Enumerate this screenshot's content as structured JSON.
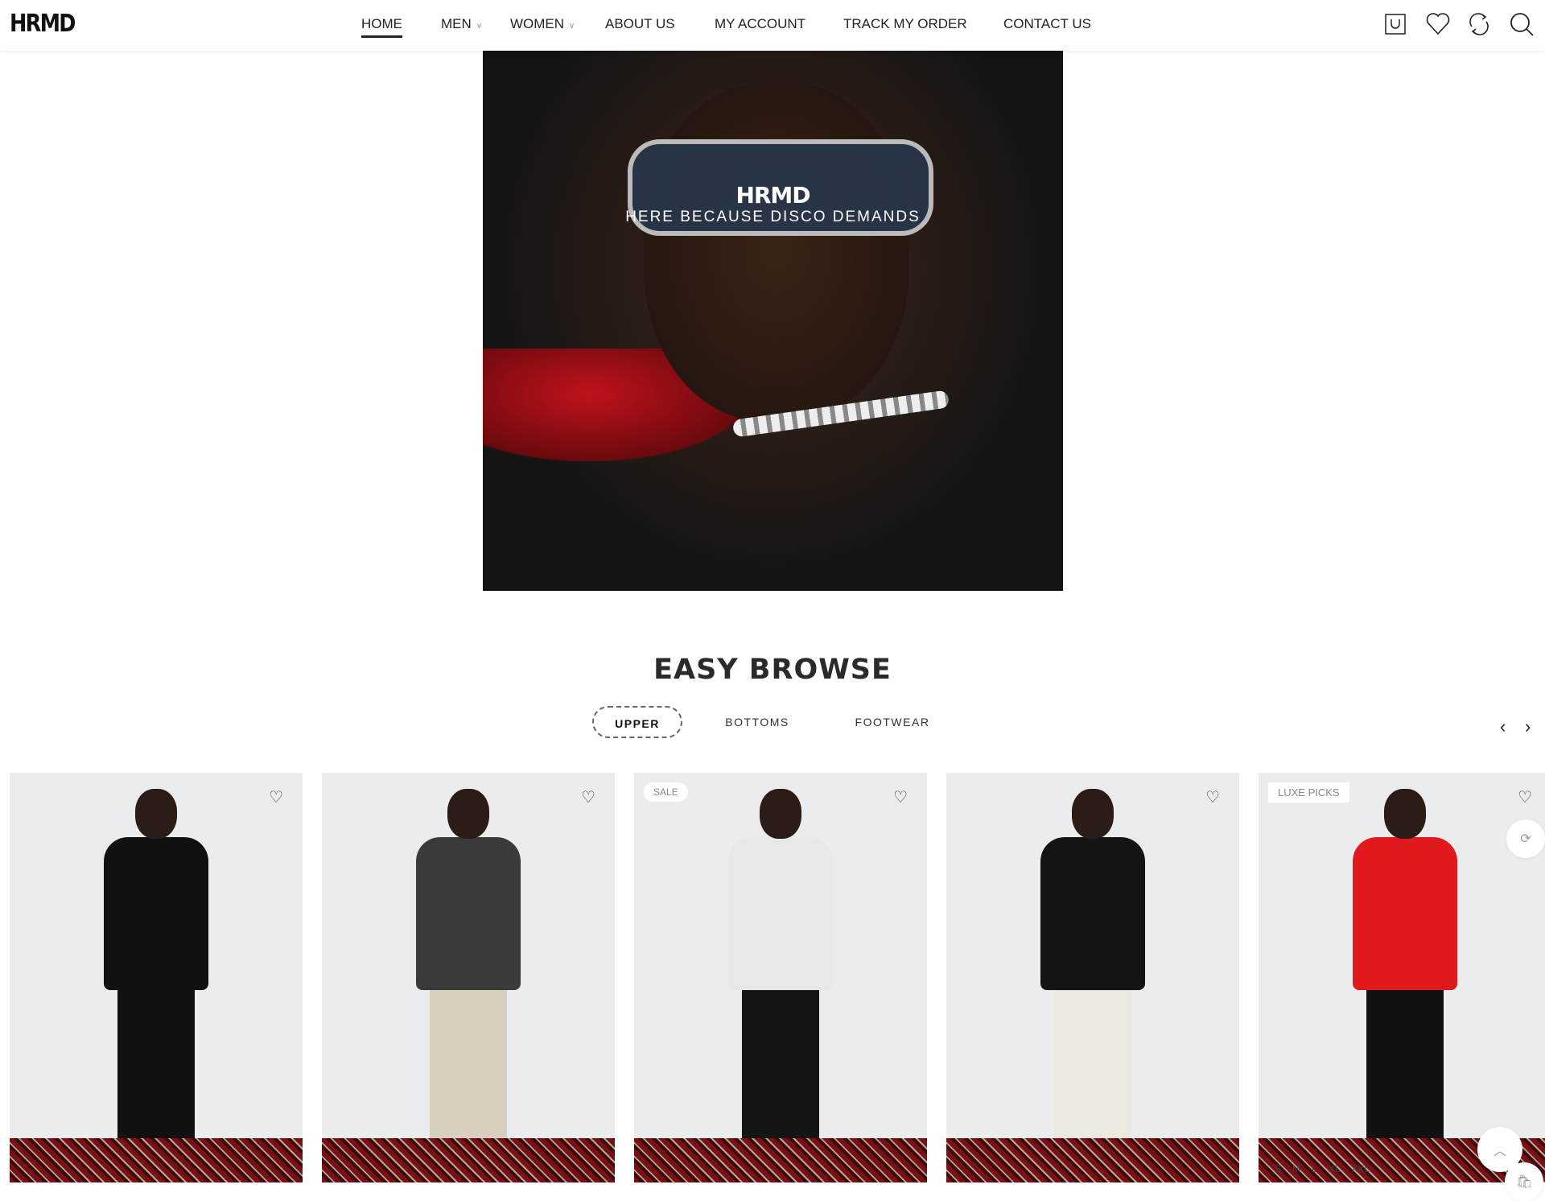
{
  "header": {
    "logo": "HRMD",
    "nav": [
      {
        "label": "HOME",
        "active": true
      },
      {
        "label": "MEN",
        "dropdown": true
      },
      {
        "label": "WOMEN",
        "dropdown": true
      },
      {
        "label": "ABOUT US"
      },
      {
        "label": "MY ACCOUNT"
      },
      {
        "label": "TRACK MY ORDER"
      },
      {
        "label": "CONTACT US"
      }
    ],
    "icons": [
      "cart-icon",
      "heart-icon",
      "compare-icon",
      "search-icon"
    ]
  },
  "hero": {
    "brand": "HRMD",
    "tagline": "HERE BECAUSE DISCO DEMANDS"
  },
  "section": {
    "title": "EASY BROWSE",
    "tabs": [
      "UPPER",
      "BOTTOMS",
      "FOOTWEAR"
    ],
    "active_tab": "UPPER",
    "prev": "‹",
    "next": "›"
  },
  "products": [
    {
      "badge": "",
      "shirt": "#111111",
      "pants": "#111111"
    },
    {
      "badge": "",
      "shirt": "#3a3a3a",
      "pants": "#d8cfc0"
    },
    {
      "badge": "SALE",
      "shirt": "#e8e8e8",
      "pants": "#151515"
    },
    {
      "badge": "",
      "shirt": "#141414",
      "pants": "#ece8df"
    },
    {
      "badge": "LUXE PICKS",
      "shirt": "#e0191f",
      "pants": "#111111",
      "sizes": [
        "S",
        "M",
        "L",
        "XL",
        "XXL"
      ]
    }
  ],
  "colors": {
    "accent": "#222222",
    "card_bg": "#ebecee"
  }
}
